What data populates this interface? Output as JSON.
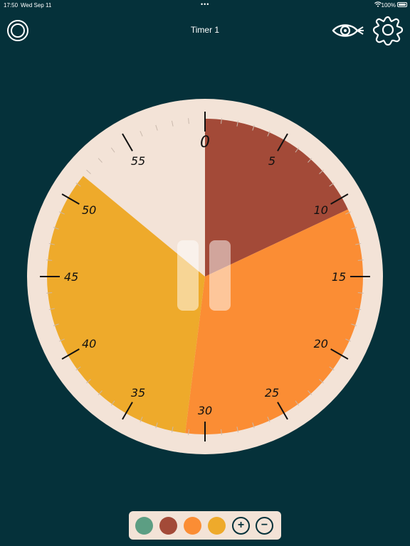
{
  "status_bar": {
    "time": "17:50",
    "date": "Wed Sep 11",
    "dots": "•••",
    "battery": "100%"
  },
  "header": {
    "title": "Timer 1"
  },
  "dial": {
    "labels": [
      "0",
      "5",
      "10",
      "15",
      "20",
      "25",
      "30",
      "35",
      "40",
      "45",
      "50",
      "55"
    ],
    "face_color": "#f3e3d7",
    "ring_color": "#f3e3d7",
    "segments": [
      {
        "start_min": 0,
        "end_min": 10.8,
        "color": "#a34a38"
      },
      {
        "start_min": 10.8,
        "end_min": 31.2,
        "color": "#fb8d34"
      },
      {
        "start_min": 31.2,
        "end_min": 51.6,
        "color": "#eeaa2b"
      }
    ]
  },
  "palette": {
    "colors": [
      "#5c9e83",
      "#a34a38",
      "#fb8d34",
      "#eeaa2b"
    ],
    "plus": "+",
    "minus": "−"
  }
}
